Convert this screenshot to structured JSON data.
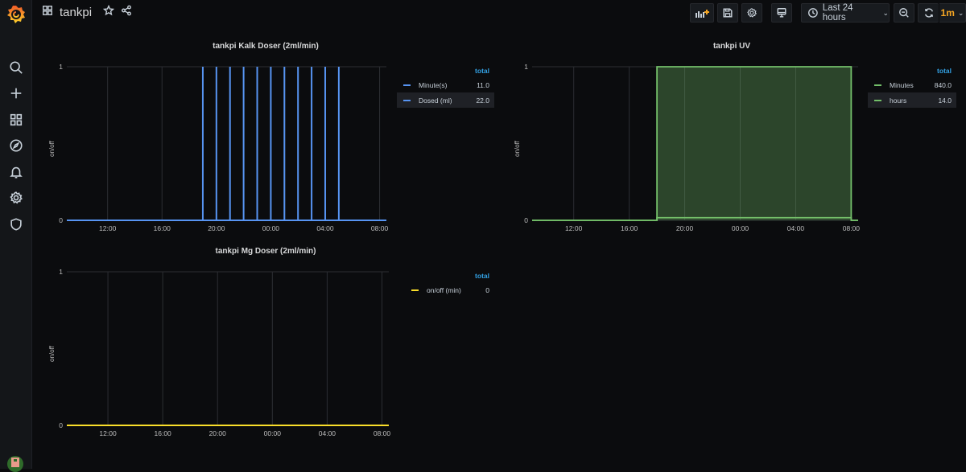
{
  "app": {
    "dashboard_title": "tankpi",
    "brand_color": "#f46800"
  },
  "sidebar": {
    "items": [
      {
        "name": "search",
        "icon": "search-icon"
      },
      {
        "name": "create",
        "icon": "plus-icon"
      },
      {
        "name": "dashboards",
        "icon": "grid-icon"
      },
      {
        "name": "explore",
        "icon": "compass-icon"
      },
      {
        "name": "alerting",
        "icon": "bell-icon"
      },
      {
        "name": "configuration",
        "icon": "gear-icon"
      },
      {
        "name": "server-admin",
        "icon": "shield-icon"
      }
    ]
  },
  "toolbar": {
    "add_panel": "add-panel-icon",
    "save": "save-icon",
    "settings": "gear-icon",
    "cycle_view": "monitor-icon",
    "time_range": "Last 24 hours",
    "zoom_out": "zoom-out-icon",
    "refresh": "refresh-icon",
    "refresh_interval": "1m"
  },
  "panels": [
    {
      "id": "kalk",
      "title": "tankpi Kalk Doser (2ml/min)",
      "y_axis_label": "on/off",
      "legend_header": "total",
      "legend": [
        {
          "name": "Minute(s)",
          "value": "11.0",
          "color": "#5794f2"
        },
        {
          "name": "Dosed (ml)",
          "value": "22.0",
          "color": "#5794f2"
        }
      ]
    },
    {
      "id": "uv",
      "title": "tankpi UV",
      "y_axis_label": "on/off",
      "legend_header": "total",
      "legend": [
        {
          "name": "Minutes",
          "value": "840.0",
          "color": "#73bf69"
        },
        {
          "name": "hours",
          "value": "14.0",
          "color": "#73bf69"
        }
      ]
    },
    {
      "id": "mg",
      "title": "tankpi Mg Doser (2ml/min)",
      "y_axis_label": "on/off",
      "legend_header": "total",
      "legend": [
        {
          "name": "on/off (min)",
          "value": "0",
          "color": "#fade2a"
        }
      ]
    }
  ],
  "chart_data": [
    {
      "type": "line",
      "title": "tankpi Kalk Doser (2ml/min)",
      "ylabel": "on/off",
      "ylim": [
        0,
        1
      ],
      "yticks": [
        "0",
        "1"
      ],
      "xlim_hours": [
        9,
        32.5
      ],
      "xticks": [
        {
          "h": 12,
          "label": "12:00"
        },
        {
          "h": 16,
          "label": "16:00"
        },
        {
          "h": 20,
          "label": "20:00"
        },
        {
          "h": 24,
          "label": "00:00"
        },
        {
          "h": 28,
          "label": "04:00"
        },
        {
          "h": 32,
          "label": "08:00"
        }
      ],
      "color": "#5794f2",
      "fill": false,
      "series": [
        {
          "name": "Minute(s)",
          "spikes_at_hours": [
            19,
            20,
            21,
            22,
            23,
            24,
            25,
            26,
            27,
            28,
            29
          ],
          "base": 0,
          "peak": 1
        }
      ]
    },
    {
      "type": "area",
      "title": "tankpi UV",
      "ylabel": "on/off",
      "ylim": [
        0,
        1
      ],
      "yticks": [
        "0",
        "1"
      ],
      "xlim_hours": [
        9,
        32.5
      ],
      "xticks": [
        {
          "h": 12,
          "label": "12:00"
        },
        {
          "h": 16,
          "label": "16:00"
        },
        {
          "h": 20,
          "label": "20:00"
        },
        {
          "h": 24,
          "label": "00:00"
        },
        {
          "h": 28,
          "label": "04:00"
        },
        {
          "h": 32,
          "label": "08:00"
        }
      ],
      "color": "#73bf69",
      "fill": true,
      "series": [
        {
          "name": "Minutes",
          "on_from_hour": 18,
          "on_to_hour": 32,
          "value_on": 1,
          "value_off": 0
        },
        {
          "name": "hours",
          "on_from_hour": 18,
          "on_to_hour": 32,
          "value_on": 0.017,
          "value_off": 0
        }
      ]
    },
    {
      "type": "line",
      "title": "tankpi Mg Doser (2ml/min)",
      "ylabel": "on/off",
      "ylim": [
        0,
        1
      ],
      "yticks": [
        "0",
        "1"
      ],
      "xlim_hours": [
        9,
        32.5
      ],
      "xticks": [
        {
          "h": 12,
          "label": "12:00"
        },
        {
          "h": 16,
          "label": "16:00"
        },
        {
          "h": 20,
          "label": "20:00"
        },
        {
          "h": 24,
          "label": "00:00"
        },
        {
          "h": 28,
          "label": "04:00"
        },
        {
          "h": 32,
          "label": "08:00"
        }
      ],
      "color": "#fade2a",
      "fill": false,
      "series": [
        {
          "name": "on/off (min)",
          "constant": 0
        }
      ]
    }
  ]
}
